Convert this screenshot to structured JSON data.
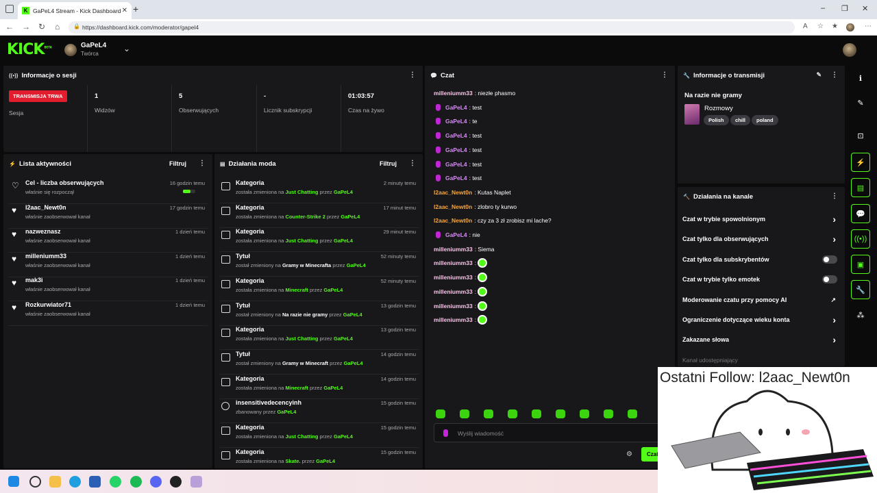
{
  "browser": {
    "tab_title": "GaPeL4 Stream - Kick Dashboard",
    "tab_close": "✕",
    "new_tab": "+",
    "url": "https://dashboard.kick.com/moderator/gapel4",
    "win_min": "–",
    "win_max": "❐",
    "win_close": "✕"
  },
  "header": {
    "logo": "KICK",
    "logo_badge": "BETA",
    "channel_name": "GaPeL4",
    "channel_role": "Twórca"
  },
  "session": {
    "title": "Informacje o sesji",
    "live_badge": "TRANSMISJA TRWA",
    "live_label": "Sesja",
    "stats": [
      {
        "value": "1",
        "label": "Widzów"
      },
      {
        "value": "5",
        "label": "Obserwujących"
      },
      {
        "value": "-",
        "label": "Licznik subskrypcji"
      },
      {
        "value": "01:03:57",
        "label": "Czas na żywo"
      }
    ]
  },
  "activity": {
    "title": "Lista aktywności",
    "filter": "Filtruj",
    "goal_progress": 0.6,
    "items": [
      {
        "name": "Cel - liczba obserwujących",
        "sub": "właśnie się rozpoczął",
        "time": "16 godzin temu"
      },
      {
        "name": "l2aac_Newt0n",
        "sub": "właśnie zaobserwował kanał",
        "time": "17 godzin temu"
      },
      {
        "name": "nazweznasz",
        "sub": "właśnie zaobserwował kanał",
        "time": "1 dzień temu"
      },
      {
        "name": "milleniumm33",
        "sub": "właśnie zaobserwował kanał",
        "time": "1 dzień temu"
      },
      {
        "name": "mak3i",
        "sub": "właśnie zaobserwował kanał",
        "time": "1 dzień temu"
      },
      {
        "name": "Rozkurwiator71",
        "sub": "właśnie zaobserwował kanał",
        "time": "1 dzień temu"
      }
    ]
  },
  "mod": {
    "title": "Działania moda",
    "filter": "Filtruj",
    "items": [
      {
        "type": "Kategoria",
        "p1": "została zmieniona na ",
        "target": "Just Chatting",
        "p2": " przez ",
        "by": "GaPeL4",
        "time": "2 minuty temu"
      },
      {
        "type": "Kategoria",
        "p1": "została zmieniona na ",
        "target": "Counter-Strike 2",
        "p2": " przez ",
        "by": "GaPeL4",
        "time": "17 minut temu"
      },
      {
        "type": "Kategoria",
        "p1": "została zmieniona na ",
        "target": "Just Chatting",
        "p2": " przez ",
        "by": "GaPeL4",
        "time": "29 minut temu"
      },
      {
        "type": "Tytuł",
        "p1": "został zmieniony na ",
        "target": "Gramy w Minecrafta",
        "p2": " przez ",
        "by": "GaPeL4",
        "time": "52 minuty temu"
      },
      {
        "type": "Kategoria",
        "p1": "została zmieniona na ",
        "target": "Minecraft",
        "p2": " przez ",
        "by": "GaPeL4",
        "time": "52 minuty temu"
      },
      {
        "type": "Tytuł",
        "p1": "został zmieniony na ",
        "target": "Na razie nie gramy",
        "p2": " przez ",
        "by": "GaPeL4",
        "time": "13 godzin temu"
      },
      {
        "type": "Kategoria",
        "p1": "została zmieniona na ",
        "target": "Just Chatting",
        "p2": " przez ",
        "by": "GaPeL4",
        "time": "13 godzin temu"
      },
      {
        "type": "Tytuł",
        "p1": "został zmieniony na ",
        "target": "Gramy w Minecraft",
        "p2": " przez ",
        "by": "GaPeL4",
        "time": "14 godzin temu"
      },
      {
        "type": "Kategoria",
        "p1": "została zmieniona na ",
        "target": "Minecraft",
        "p2": " przez ",
        "by": "GaPeL4",
        "time": "14 godzin temu"
      },
      {
        "type": "insensitivedecencyinh",
        "p1": "zbanowany przez ",
        "target": "",
        "p2": "",
        "by": "GaPeL4",
        "time": "15 godzin temu"
      },
      {
        "type": "Kategoria",
        "p1": "została zmieniona na ",
        "target": "Just Chatting",
        "p2": " przez ",
        "by": "GaPeL4",
        "time": "15 godzin temu"
      },
      {
        "type": "Kategoria",
        "p1": "została zmieniona na ",
        "target": "Skate.",
        "p2": " przez ",
        "by": "GaPeL4",
        "time": "15 godzin temu"
      }
    ]
  },
  "chat": {
    "title": "Czat",
    "input_placeholder": "Wyślij wiadomość",
    "send": "Czat",
    "messages": [
      {
        "user": "milleniumm33",
        "color": "#f7c6e8",
        "text": ": niezłe phasmo",
        "mic": false,
        "emote": false
      },
      {
        "user": "GaPeL4",
        "color": "#d48ef0",
        "text": ": test",
        "mic": true,
        "emote": false
      },
      {
        "user": "GaPeL4",
        "color": "#d48ef0",
        "text": ": te",
        "mic": true,
        "emote": false
      },
      {
        "user": "GaPeL4",
        "color": "#d48ef0",
        "text": ": test",
        "mic": true,
        "emote": false
      },
      {
        "user": "GaPeL4",
        "color": "#d48ef0",
        "text": ": test",
        "mic": true,
        "emote": false
      },
      {
        "user": "GaPeL4",
        "color": "#d48ef0",
        "text": ": test",
        "mic": true,
        "emote": false
      },
      {
        "user": "GaPeL4",
        "color": "#d48ef0",
        "text": ": test",
        "mic": true,
        "emote": false
      },
      {
        "user": "l2aac_Newt0n",
        "color": "#f5a742",
        "text": ": Kutas Naplet",
        "mic": false,
        "emote": false
      },
      {
        "user": "l2aac_Newt0n",
        "color": "#f5a742",
        "text": ": zlobro ty kurwo",
        "mic": false,
        "emote": false
      },
      {
        "user": "l2aac_Newt0n",
        "color": "#f5a742",
        "text": ": czy za 3 zł zrobisz mi lache?",
        "mic": false,
        "emote": false
      },
      {
        "user": "GaPeL4",
        "color": "#d48ef0",
        "text": ": nie",
        "mic": true,
        "emote": false
      },
      {
        "user": "milleniumm33",
        "color": "#f7c6e8",
        "text": ": Siema",
        "mic": false,
        "emote": false
      },
      {
        "user": "milleniumm33",
        "color": "#f7c6e8",
        "text": ":",
        "mic": false,
        "emote": true
      },
      {
        "user": "milleniumm33",
        "color": "#f7c6e8",
        "text": ":",
        "mic": false,
        "emote": true
      },
      {
        "user": "milleniumm33",
        "color": "#f7c6e8",
        "text": ":",
        "mic": false,
        "emote": true
      },
      {
        "user": "milleniumm33",
        "color": "#f7c6e8",
        "text": ":",
        "mic": false,
        "emote": true
      },
      {
        "user": "milleniumm33",
        "color": "#f7c6e8",
        "text": ":",
        "mic": false,
        "emote": true
      }
    ]
  },
  "stream_info": {
    "title": "Informacje o transmisji",
    "stream_title": "Na razie nie gramy",
    "category": "Rozmowy",
    "tags": [
      "Polish",
      "chill",
      "poland"
    ]
  },
  "channel_actions": {
    "title": "Działania na kanale",
    "items": [
      {
        "label": "Czat w trybie spowolnionym",
        "control": "arrow"
      },
      {
        "label": "Czat tylko dla obserwujących",
        "control": "arrow"
      },
      {
        "label": "Czat tylko dla subskrybentów",
        "control": "toggle"
      },
      {
        "label": "Czat w trybie tylko emotek",
        "control": "toggle"
      },
      {
        "label": "Moderowanie czatu przy pomocy AI",
        "control": "external"
      },
      {
        "label": "Ograniczenie dotyczące wieku konta",
        "control": "arrow"
      },
      {
        "label": "Zakazane słowa",
        "control": "arrow"
      },
      {
        "label": "Kanał udostępniający",
        "control": "none"
      }
    ]
  },
  "overlay": {
    "text": "Ostatni Follow: l2aac_Newt0n"
  },
  "colors": {
    "accent": "#53fc18",
    "live": "#e11d2e",
    "panel": "#18181b"
  }
}
